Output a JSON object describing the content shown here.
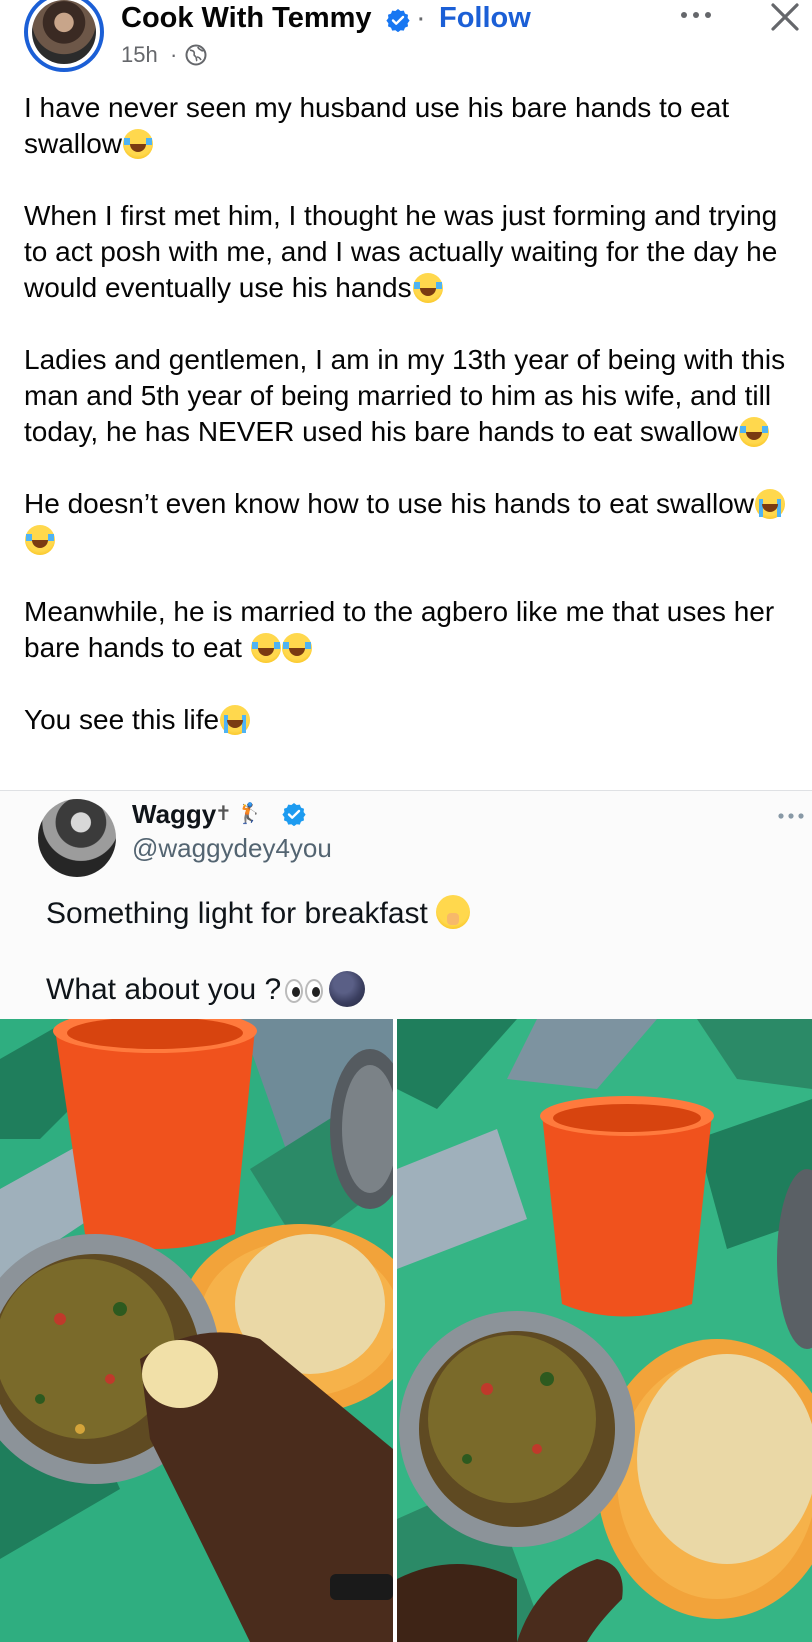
{
  "post": {
    "author": "Cook With Temmy",
    "separator": "·",
    "follow_label": "Follow",
    "time": "15h",
    "time_dot": "·",
    "paragraphs": [
      {
        "text": "I have never seen my husband use his bare hands to eat swallow",
        "emojis": [
          "joy"
        ]
      },
      {
        "text": "When I first met him, I thought he was just forming and trying to act posh with me, and I was actually waiting for the day he would eventually use his hands",
        "emojis": [
          "joy"
        ]
      },
      {
        "text": "Ladies and gentlemen, I am in my 13th year of being with this man and 5th year of being married to him as his wife, and till today, he has NEVER used his bare hands to eat swallow",
        "emojis": [
          "joy"
        ]
      },
      {
        "text": "He doesn’t even know how to use his hands to eat swallow",
        "emojis": [
          "cry",
          "joy"
        ]
      },
      {
        "text": "Meanwhile, he is married to the agbero like me that uses her bare hands to eat ",
        "emojis": [
          "joy",
          "joy"
        ]
      },
      {
        "text": "You see this life",
        "emojis": [
          "cry"
        ]
      }
    ]
  },
  "tweet": {
    "name": "Waggy",
    "badges": "✝ 🏌",
    "handle": "@waggydey4you",
    "line1": "Something light for breakfast",
    "line2": "What about you ?"
  },
  "icons": {
    "verified": "verified-badge-icon",
    "globe": "globe-icon",
    "more": "more-options-icon",
    "close": "close-icon"
  },
  "colors": {
    "follow": "#1b5fd6",
    "verified": "#1877f2",
    "tweet_verified": "#1d9bf0",
    "secondary_text": "#65676b"
  }
}
